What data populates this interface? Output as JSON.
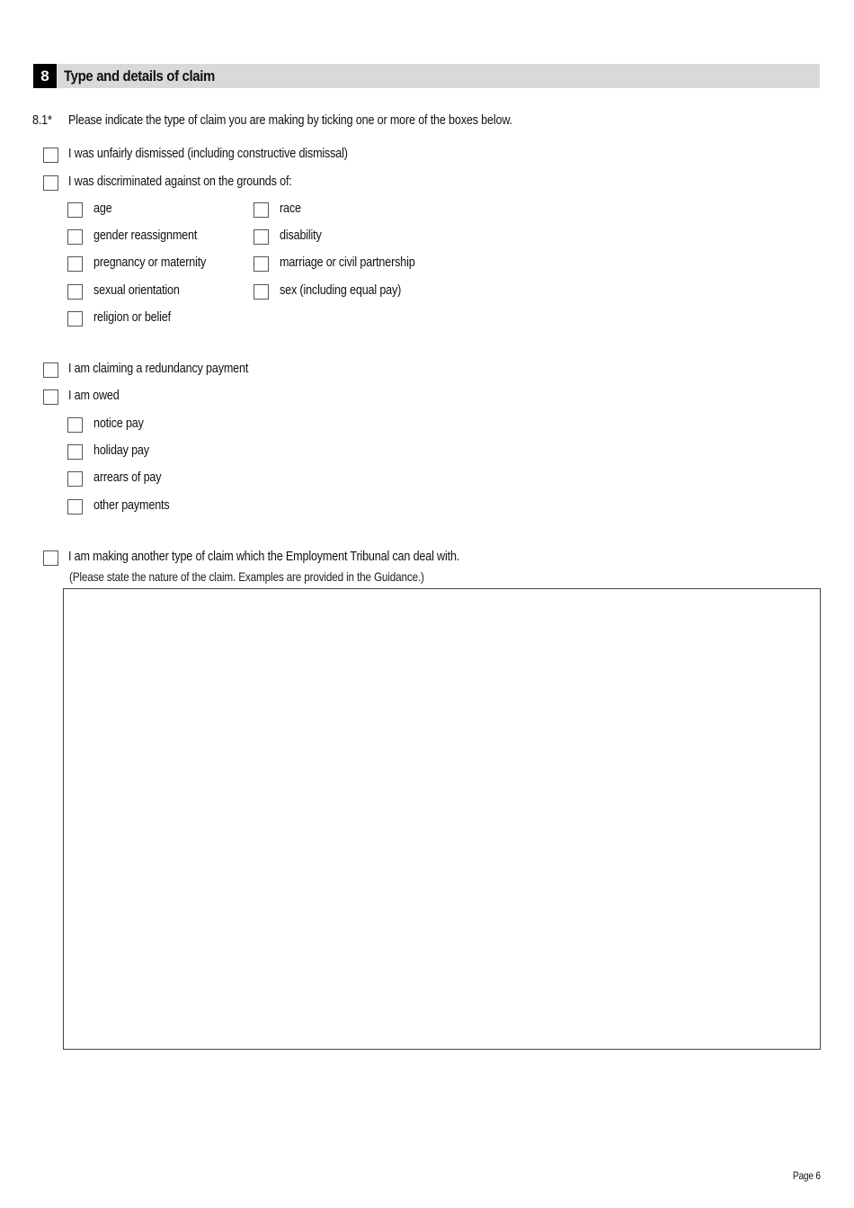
{
  "section": {
    "number": "8",
    "title": "Type and details of claim"
  },
  "question": {
    "number": "8.1*",
    "text": "Please indicate the type of claim you are making by ticking one or more of the boxes below."
  },
  "options": {
    "unfair_dismissal": "I was unfairly dismissed (including constructive dismissal)",
    "discrimination": "I was discriminated against on the grounds of:",
    "discrimination_grounds_left": [
      "age",
      "gender reassignment",
      "pregnancy or maternity",
      "sexual orientation",
      "religion or belief"
    ],
    "discrimination_grounds_right": [
      "race",
      "disability",
      "marriage or civil partnership",
      "sex (including equal pay)"
    ],
    "redundancy": "I am claiming a redundancy payment",
    "owed": "I am owed",
    "owed_items": [
      "notice pay",
      "holiday pay",
      "arrears of pay",
      "other payments"
    ],
    "other_claim": "I am making another type of claim which the Employment Tribunal can deal with.",
    "other_claim_note": "(Please state the nature of the claim. Examples are provided in the Guidance.)"
  },
  "other_claim_details": "",
  "footer": {
    "page": "Page 6"
  }
}
